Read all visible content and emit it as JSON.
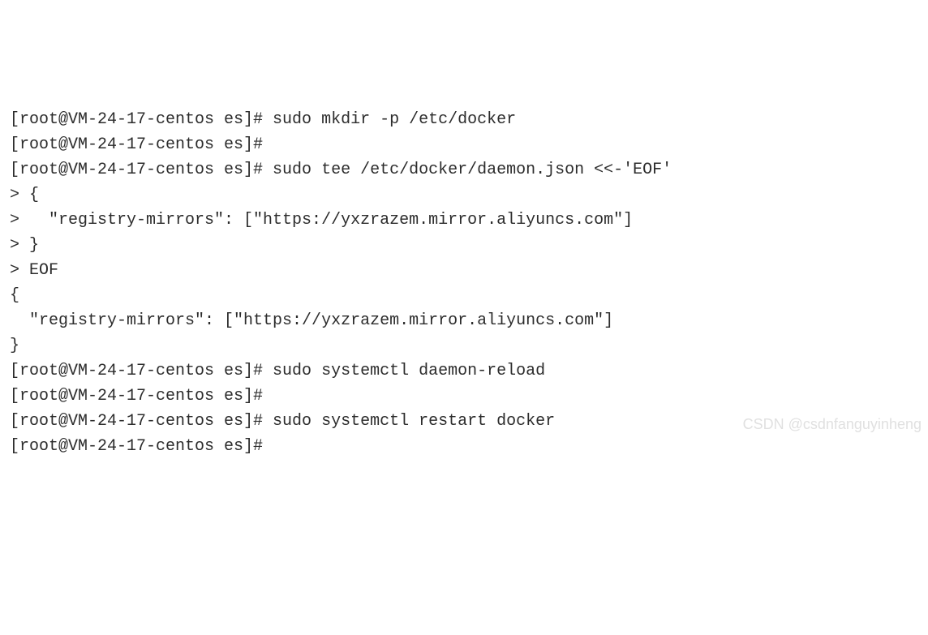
{
  "terminal": {
    "lines": [
      "[root@VM-24-17-centos es]# sudo mkdir -p /etc/docker",
      "[root@VM-24-17-centos es]#",
      "[root@VM-24-17-centos es]# sudo tee /etc/docker/daemon.json <<-'EOF'",
      "> {",
      ">   \"registry-mirrors\": [\"https://yxzrazem.mirror.aliyuncs.com\"]",
      "> }",
      "> EOF",
      "{",
      "  \"registry-mirrors\": [\"https://yxzrazem.mirror.aliyuncs.com\"]",
      "}",
      "[root@VM-24-17-centos es]# sudo systemctl daemon-reload",
      "[root@VM-24-17-centos es]#",
      "[root@VM-24-17-centos es]# sudo systemctl restart docker",
      "",
      "[root@VM-24-17-centos es]#"
    ]
  },
  "watermark": "CSDN @csdnfanguyinheng"
}
